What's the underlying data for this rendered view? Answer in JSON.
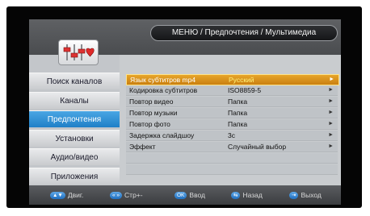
{
  "header": {
    "breadcrumb": "МЕНЮ / Предпочтения / Мультимедиа"
  },
  "logo": {
    "icon": "equalizer-heart-icon"
  },
  "sidebar": {
    "items": [
      {
        "label": "Поиск каналов"
      },
      {
        "label": "Каналы"
      },
      {
        "label": "Предпочтения",
        "active": true
      },
      {
        "label": "Установки"
      },
      {
        "label": "Аудио/видео"
      },
      {
        "label": "Приложения"
      }
    ]
  },
  "settings": {
    "rows": [
      {
        "label": "Язык субтитров mp4",
        "value": "Русский",
        "selected": true
      },
      {
        "label": "Кодировка субтитров",
        "value": "ISO8859-5"
      },
      {
        "label": "Повтор видео",
        "value": "Папка"
      },
      {
        "label": "Повтор музыки",
        "value": "Папка"
      },
      {
        "label": "Повтор фото",
        "value": "Папка"
      },
      {
        "label": "Задержка слайдшоу",
        "value": "3с"
      },
      {
        "label": "Эффект",
        "value": "Случайный выбор"
      }
    ],
    "arrow_glyph": "►"
  },
  "footer": {
    "hints": [
      {
        "key": "▲▼",
        "label": "Двиг."
      },
      {
        "key": "« »",
        "label": "Стр+-"
      },
      {
        "key": "OK",
        "label": "Ввод"
      },
      {
        "key": "⇆",
        "label": "Назад"
      },
      {
        "key": "⇥",
        "label": "Выход"
      }
    ]
  },
  "colors": {
    "accent_selected": "#e0a020",
    "active_menu": "#2f8fd6",
    "panel": "#c3c6ca"
  }
}
